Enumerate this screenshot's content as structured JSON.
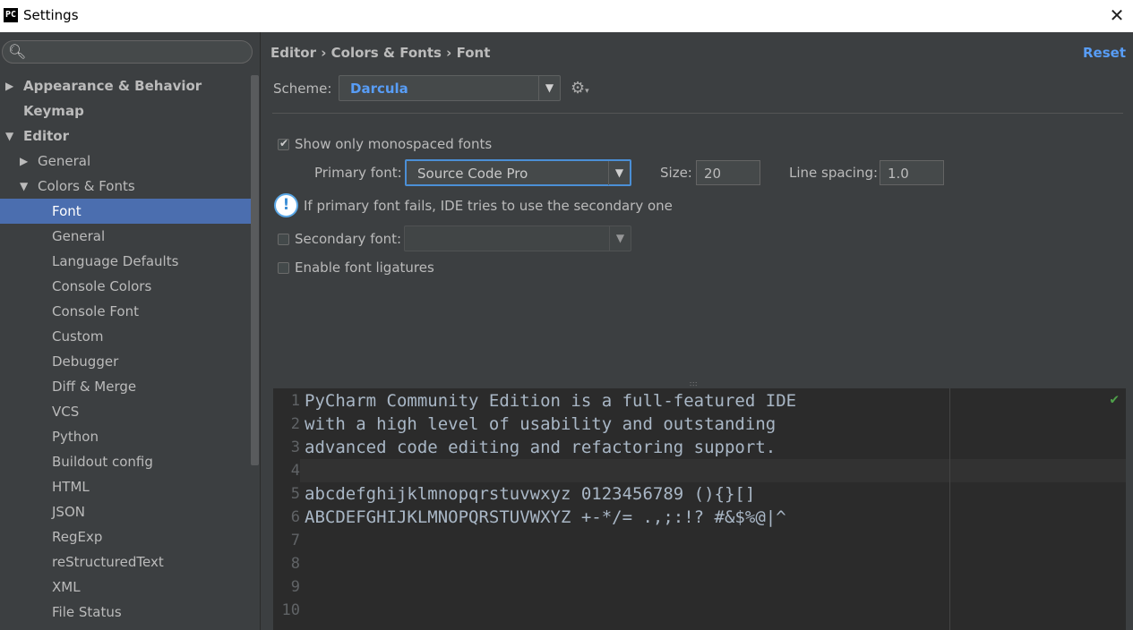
{
  "window": {
    "title": "Settings",
    "app_icon_text": "PC"
  },
  "search": {
    "placeholder": ""
  },
  "sidebar": {
    "items": [
      {
        "label": "Appearance & Behavior",
        "level": 0,
        "arrow": "▶",
        "bold": true
      },
      {
        "label": "Keymap",
        "level": 0,
        "arrow": "",
        "bold": true
      },
      {
        "label": "Editor",
        "level": 0,
        "arrow": "▼",
        "bold": true
      },
      {
        "label": "General",
        "level": 1,
        "arrow": "▶"
      },
      {
        "label": "Colors & Fonts",
        "level": 1,
        "arrow": "▼"
      },
      {
        "label": "Font",
        "level": 2,
        "arrow": "",
        "selected": true
      },
      {
        "label": "General",
        "level": 2,
        "arrow": ""
      },
      {
        "label": "Language Defaults",
        "level": 2,
        "arrow": ""
      },
      {
        "label": "Console Colors",
        "level": 2,
        "arrow": ""
      },
      {
        "label": "Console Font",
        "level": 2,
        "arrow": ""
      },
      {
        "label": "Custom",
        "level": 2,
        "arrow": ""
      },
      {
        "label": "Debugger",
        "level": 2,
        "arrow": ""
      },
      {
        "label": "Diff & Merge",
        "level": 2,
        "arrow": ""
      },
      {
        "label": "VCS",
        "level": 2,
        "arrow": ""
      },
      {
        "label": "Python",
        "level": 2,
        "arrow": ""
      },
      {
        "label": "Buildout config",
        "level": 2,
        "arrow": ""
      },
      {
        "label": "HTML",
        "level": 2,
        "arrow": ""
      },
      {
        "label": "JSON",
        "level": 2,
        "arrow": ""
      },
      {
        "label": "RegExp",
        "level": 2,
        "arrow": ""
      },
      {
        "label": "reStructuredText",
        "level": 2,
        "arrow": ""
      },
      {
        "label": "XML",
        "level": 2,
        "arrow": ""
      },
      {
        "label": "File Status",
        "level": 2,
        "arrow": ""
      }
    ]
  },
  "header": {
    "breadcrumb": "Editor › Colors & Fonts › Font",
    "reset_label": "Reset"
  },
  "scheme": {
    "label": "Scheme:",
    "value": "Darcula"
  },
  "font_settings": {
    "monospaced_label": "Show only monospaced fonts",
    "monospaced_checked": true,
    "primary_label": "Primary font:",
    "primary_value": "Source Code Pro",
    "size_label": "Size:",
    "size_value": "20",
    "line_spacing_label": "Line spacing:",
    "line_spacing_value": "1.0",
    "info_text": "If primary font fails, IDE tries to use the secondary one",
    "secondary_label": "Secondary font:",
    "secondary_value": "",
    "secondary_checked": false,
    "ligatures_label": "Enable font ligatures",
    "ligatures_checked": false
  },
  "preview": {
    "lines": [
      "PyCharm Community Edition is a full-featured IDE",
      "with a high level of usability and outstanding",
      "advanced code editing and refactoring support.",
      "",
      "abcdefghijklmnopqrstuvwxyz 0123456789 (){}[]",
      "ABCDEFGHIJKLMNOPQRSTUVWXYZ +-*/= .,;:!? #&$%@|^",
      "",
      "",
      "",
      ""
    ],
    "line_numbers": [
      "1",
      "2",
      "3",
      "4",
      "5",
      "6",
      "7",
      "8",
      "9",
      "10"
    ]
  },
  "colors": {
    "background": "#3c3f41",
    "selected": "#4b6eaf",
    "link": "#589df6",
    "editor_bg": "#2b2b2b",
    "code_text": "#a9b7c6"
  }
}
